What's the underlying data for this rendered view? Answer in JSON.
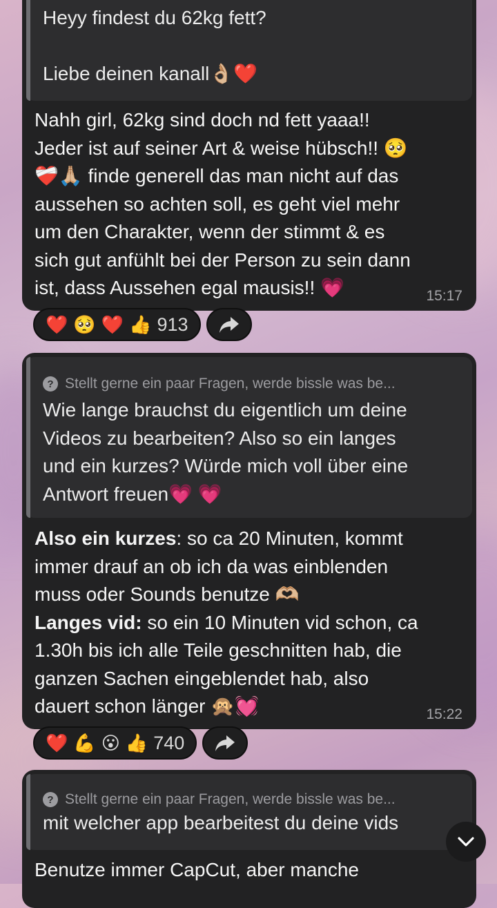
{
  "messages": [
    {
      "quote_text": "Heyy findest du 62kg fett?\n\nLiebe deinen kanall👌🏼❤️",
      "body_text": "Nahh girl, 62kg sind doch nd fett yaaa!!\nJeder ist auf seiner Art & weise hübsch!! 🥺\n❤️‍🩹🙏🏼 finde generell das man nicht auf das\naussehen so achten soll, es geht viel mehr\num den Charakter, wenn der stimmt & es\nsich gut anfühlt bei der Person zu sein dann\nist, dass Aussehen egal mausis!! 💗",
      "time": "15:17",
      "reactions": {
        "emojis": [
          "❤️",
          "🥺",
          "❤️",
          "👍"
        ],
        "count": "913"
      }
    },
    {
      "quote_header": "Stellt gerne ein paar Fragen, werde bissle was be...",
      "quote_text": "Wie lange brauchst du eigentlich um deine\nVideos zu bearbeiten? Also so ein langes\nund ein kurzes? Würde mich voll über eine\nAntwort freuen💗 💗",
      "body": {
        "part1_bold": "Also ein kurzes",
        "part1": ": so ca 20 Minuten, kommt\nimmer drauf an ob ich da was einblenden\nmuss oder Sounds benutze 🫶🏼\n",
        "part2_bold": "Langes vid:",
        "part2": " so ein 10 Minuten vid schon, ca\n1.30h bis ich alle Teile geschnitten hab, die\nganzen Sachen eingeblendet hab, also\ndauert schon länger 🙊💓"
      },
      "time": "15:22",
      "reactions": {
        "emojis": [
          "❤️",
          "💪",
          "😮",
          "👍"
        ],
        "count": "740"
      }
    },
    {
      "quote_header": "Stellt gerne ein paar Fragen, werde bissle was be...",
      "quote_text": "mit welcher app bearbeitest du deine vids",
      "body_text": "Benutze immer CapCut, aber manche"
    }
  ],
  "icons": {
    "share": "share-arrow-icon",
    "scroll_down": "chevron-down-icon",
    "question": "question-circle-icon"
  },
  "colors": {
    "bubble": "#222223",
    "quote": "#2d2d2f",
    "time": "#a6a6aa"
  }
}
